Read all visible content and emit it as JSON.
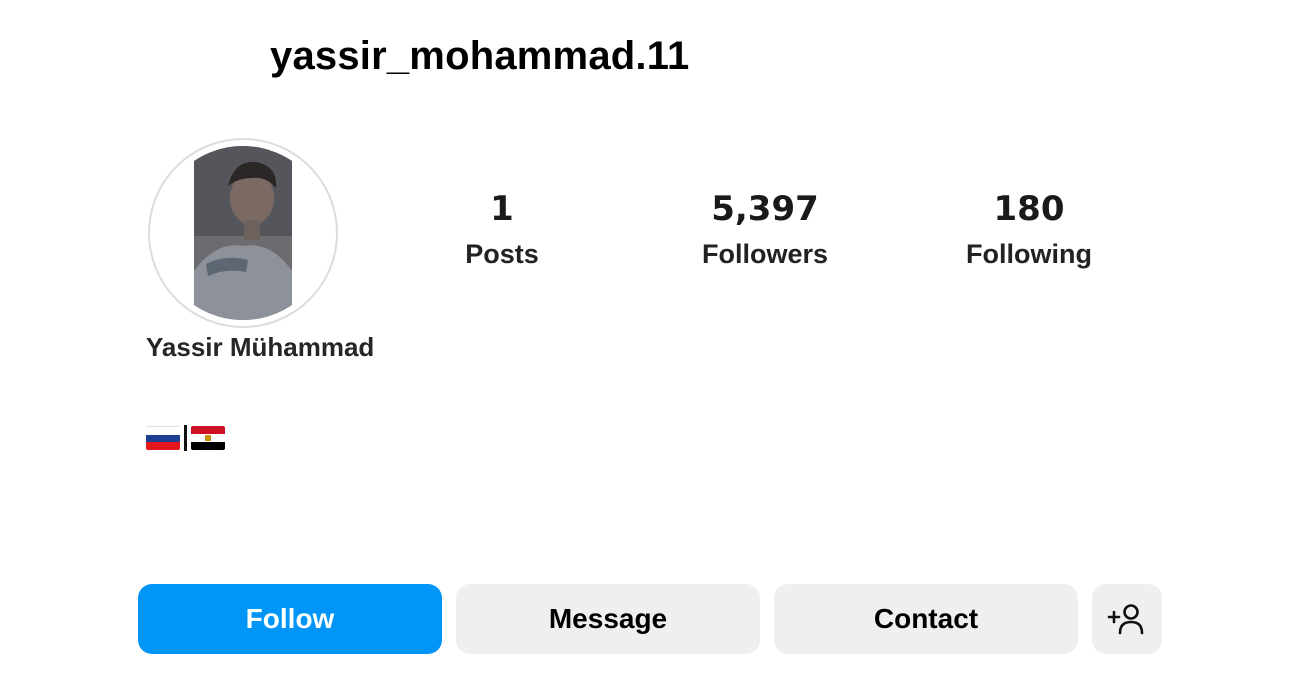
{
  "profile": {
    "username": "yassir_mohammad.11",
    "full_name": "Yassir Mühammad",
    "avatar_icon": "profile-photo",
    "bio_flags": [
      "russia-flag",
      "egypt-flag"
    ]
  },
  "stats": [
    {
      "count": "1",
      "label": "Posts"
    },
    {
      "count": "5,397",
      "label": "Followers"
    },
    {
      "count": "180",
      "label": "Following"
    }
  ],
  "actions": {
    "follow_label": "Follow",
    "message_label": "Message",
    "contact_label": "Contact",
    "add_user_icon": "add-user-icon"
  },
  "colors": {
    "follow_button": "#0095f6",
    "secondary_button": "#efefef",
    "text": "#000000"
  }
}
